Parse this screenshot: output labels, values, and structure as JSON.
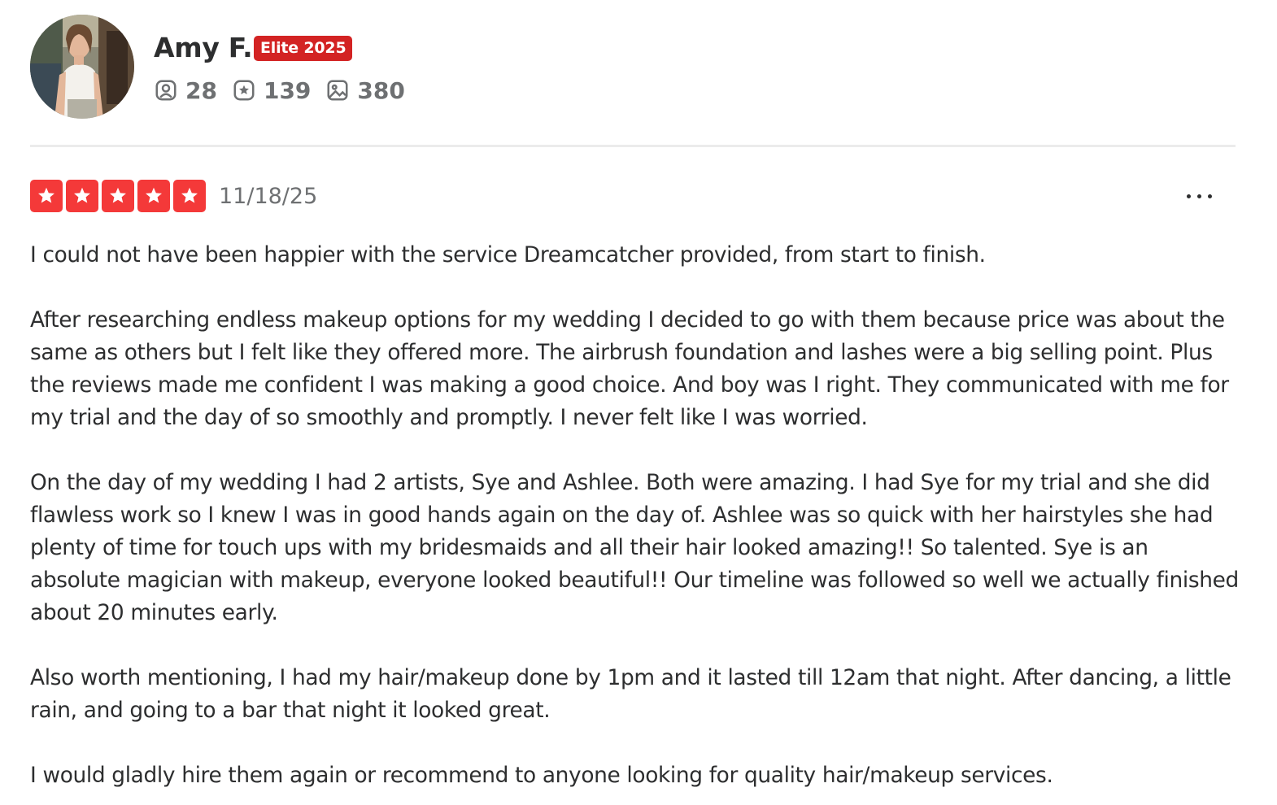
{
  "user": {
    "name": "Amy F.",
    "badge": "Elite 2025",
    "stats": {
      "friends": "28",
      "reviews": "139",
      "photos": "380"
    }
  },
  "review": {
    "rating": 5,
    "date": "11/18/25",
    "paragraphs": [
      "I could not have been happier with the service Dreamcatcher provided, from start to finish.",
      "After researching endless makeup options for my wedding I decided to go with them because price was about the same as others but I felt like they offered more. The airbrush foundation and lashes were a big selling point. Plus the reviews made me confident I was making a good choice. And boy was I right. They communicated with me for my trial and the day of so smoothly and promptly. I never felt like I was worried.",
      "On the day of my wedding I had 2 artists, Sye and Ashlee. Both were amazing. I had Sye for my trial and she did flawless work so I knew I was in good hands again on the day of. Ashlee was so quick with her hairstyles she had plenty of time for touch ups with my bridesmaids and all their hair looked amazing!! So talented. Sye is an absolute magician with makeup, everyone looked beautiful!! Our timeline was followed so well we actually finished about 20 minutes early.",
      "Also worth mentioning, I had my hair/makeup done by 1pm and it lasted till 12am that night. After dancing, a little rain, and going to a bar that night it looked great.",
      "I would gladly hire them again or recommend to anyone looking for quality hair/makeup services."
    ]
  },
  "icons": {
    "friends": "friends-icon",
    "reviews": "review-star-icon",
    "photos": "photo-icon",
    "more": "more-options-icon"
  },
  "colors": {
    "star_red": "#f43939",
    "elite_red": "#d32323",
    "muted_text": "#6e7072",
    "body_text": "#2d2e2f"
  }
}
